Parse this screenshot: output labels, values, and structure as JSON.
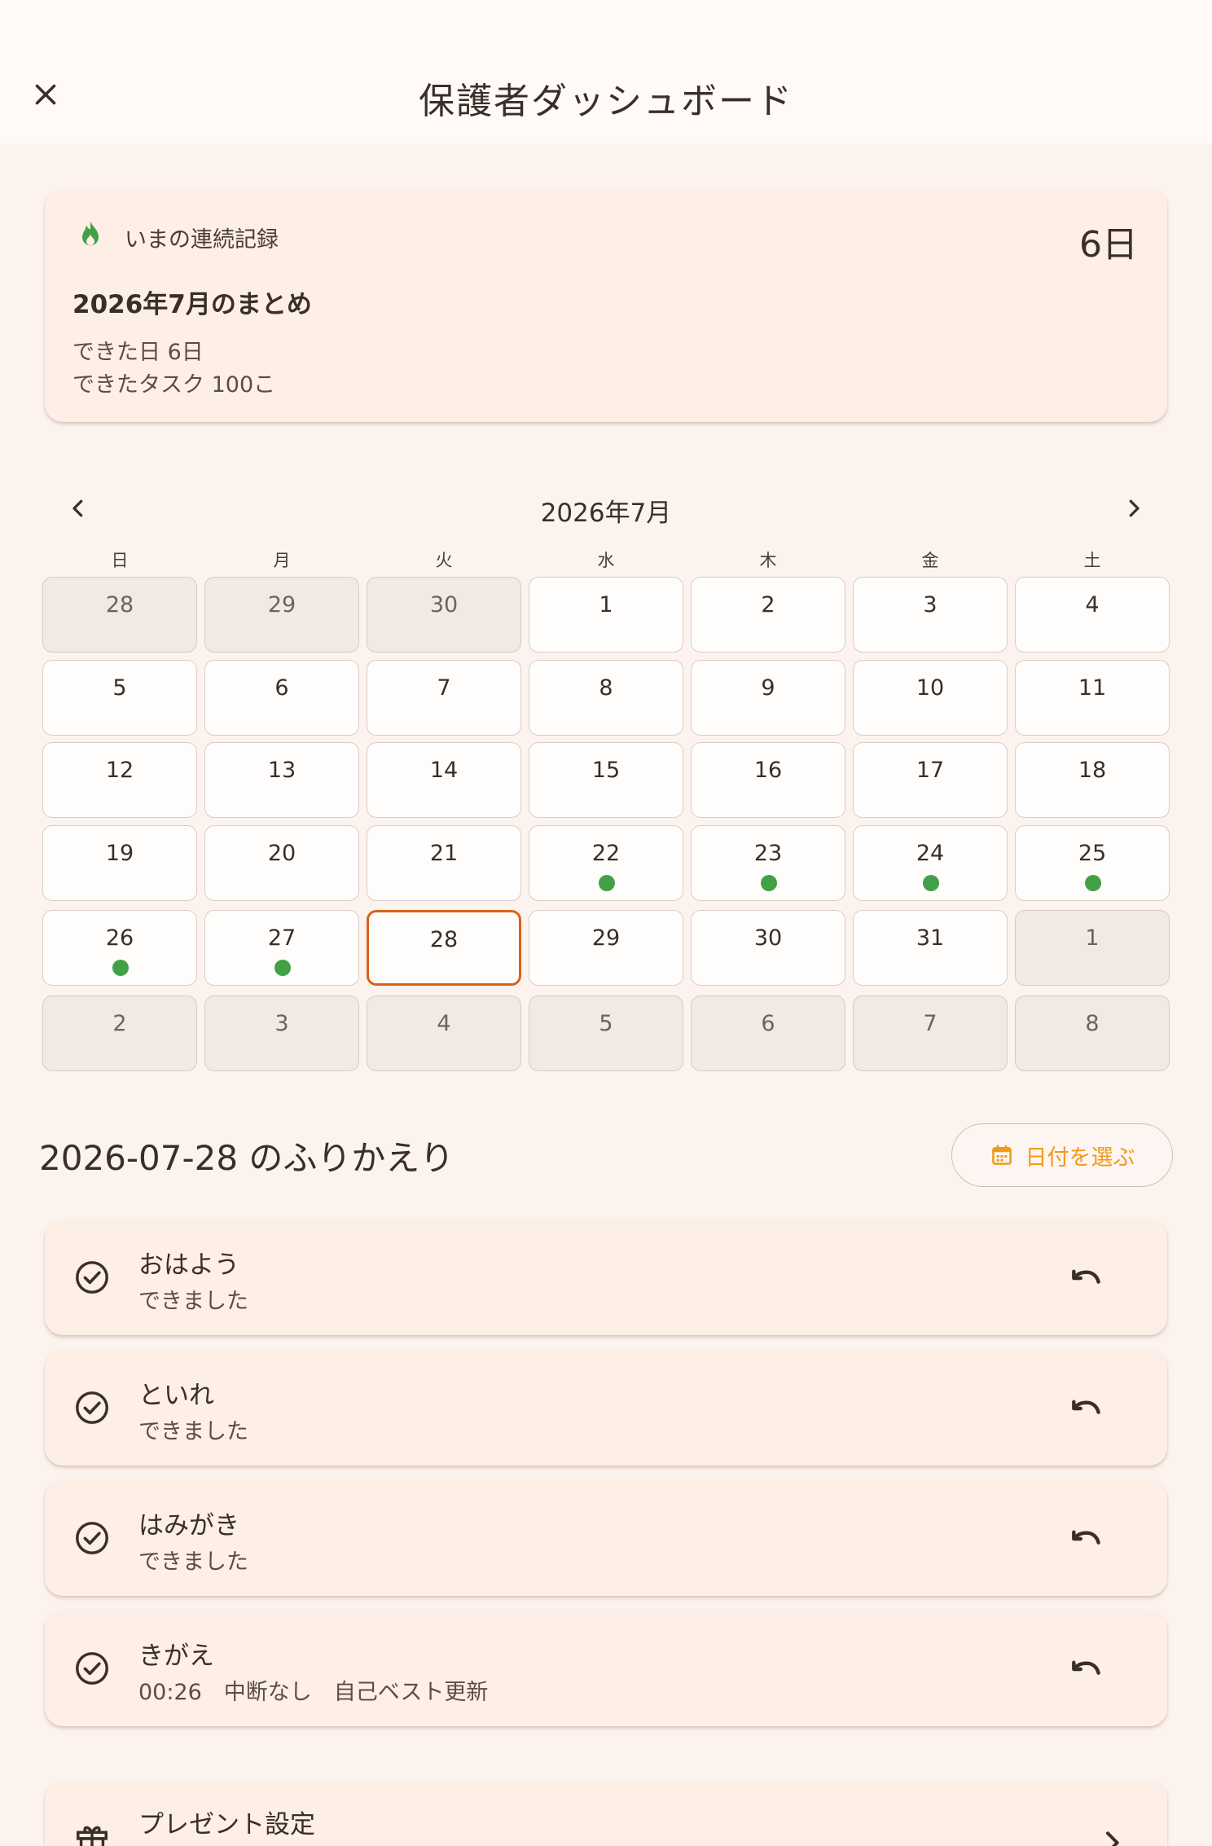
{
  "appbar": {
    "title": "保護者ダッシュボード"
  },
  "streak": {
    "label": "いまの連続記録",
    "value": "6日",
    "summary_title": "2026年7月のまとめ",
    "days_done": "できた日 6日",
    "tasks_done": "できたタスク 100こ"
  },
  "calendar": {
    "title": "2026年7月",
    "weekdays": [
      "日",
      "月",
      "火",
      "水",
      "木",
      "金",
      "土"
    ],
    "days": [
      {
        "n": "28",
        "other": true
      },
      {
        "n": "29",
        "other": true
      },
      {
        "n": "30",
        "other": true
      },
      {
        "n": "1"
      },
      {
        "n": "2"
      },
      {
        "n": "3"
      },
      {
        "n": "4"
      },
      {
        "n": "5"
      },
      {
        "n": "6"
      },
      {
        "n": "7"
      },
      {
        "n": "8"
      },
      {
        "n": "9"
      },
      {
        "n": "10"
      },
      {
        "n": "11"
      },
      {
        "n": "12"
      },
      {
        "n": "13"
      },
      {
        "n": "14"
      },
      {
        "n": "15"
      },
      {
        "n": "16"
      },
      {
        "n": "17"
      },
      {
        "n": "18"
      },
      {
        "n": "19"
      },
      {
        "n": "20"
      },
      {
        "n": "21"
      },
      {
        "n": "22",
        "done": true
      },
      {
        "n": "23",
        "done": true
      },
      {
        "n": "24",
        "done": true
      },
      {
        "n": "25",
        "done": true
      },
      {
        "n": "26",
        "done": true
      },
      {
        "n": "27",
        "done": true
      },
      {
        "n": "28",
        "selected": true
      },
      {
        "n": "29"
      },
      {
        "n": "30"
      },
      {
        "n": "31"
      },
      {
        "n": "1",
        "other": true
      },
      {
        "n": "2",
        "other": true
      },
      {
        "n": "3",
        "other": true
      },
      {
        "n": "4",
        "other": true
      },
      {
        "n": "5",
        "other": true
      },
      {
        "n": "6",
        "other": true
      },
      {
        "n": "7",
        "other": true
      },
      {
        "n": "8",
        "other": true
      }
    ],
    "done_color": "#43a047",
    "selected_color": "#d9621a"
  },
  "review": {
    "title": "2026-07-28 のふりかえり",
    "date_button": "日付を選ぶ",
    "accent_color": "#f09a1a",
    "tasks": [
      {
        "name": "おはよう",
        "status": "できました"
      },
      {
        "name": "といれ",
        "status": "できました"
      },
      {
        "name": "はみがき",
        "status": "できました"
      },
      {
        "name": "きがえ",
        "status": "00:26　中断なし　自己ベスト更新"
      }
    ]
  },
  "gift": {
    "label": "プレゼント設定"
  }
}
